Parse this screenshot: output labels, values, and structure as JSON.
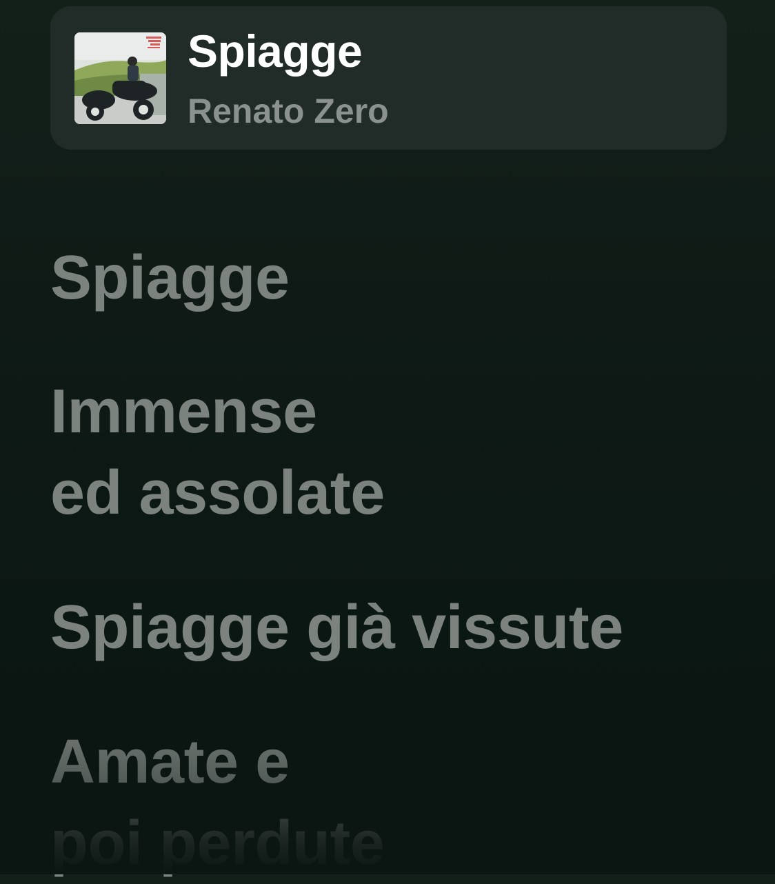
{
  "now_playing": {
    "artwork_icon": "album-cover-motorcycle",
    "title": "Spiagge",
    "artist": "Renato Zero"
  },
  "lyrics": [
    "Spiagge",
    "Immense",
    "ed assolate",
    "Spiagge già vissute",
    "Amate e",
    "poi perdute"
  ],
  "colors": {
    "background": "#0f1a16",
    "card": "#212b27",
    "title": "#ffffff",
    "artist": "#8a918e",
    "lyric": "#7c837f"
  }
}
